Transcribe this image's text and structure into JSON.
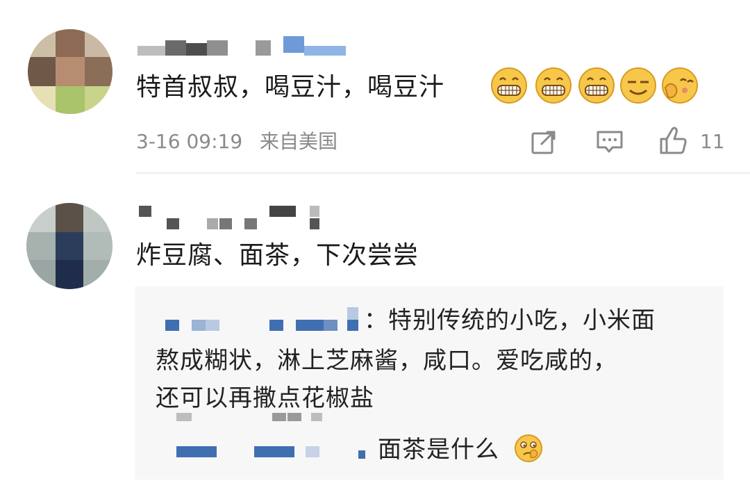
{
  "comments": [
    {
      "text": "特首叔叔，喝豆汁，喝豆汁",
      "time": "3-16 09:19",
      "source": "来自美国",
      "like_count": "11",
      "emojis": [
        "grin-emoji",
        "grin-emoji",
        "grin-emoji",
        "smirk-emoji",
        "shy-emoji"
      ]
    },
    {
      "text": "炸豆腐、面茶，下次尝尝",
      "replies": [
        {
          "lines": [
            "：特别传统的小吃，小米面",
            "熬成糊状，淋上芝麻酱，咸口。爱吃咸的，",
            "还可以再撒点花椒盐"
          ]
        },
        {
          "text": "面茶是什么",
          "emoji": "thinking-emoji"
        }
      ]
    }
  ],
  "actions": [
    "share-icon",
    "comment-icon",
    "like-icon"
  ],
  "colors": {
    "text": "#1a1a1a",
    "meta": "#8a8a8a",
    "reply_bg": "#f7f7f7",
    "censor_blue": "#3f6fb0"
  }
}
